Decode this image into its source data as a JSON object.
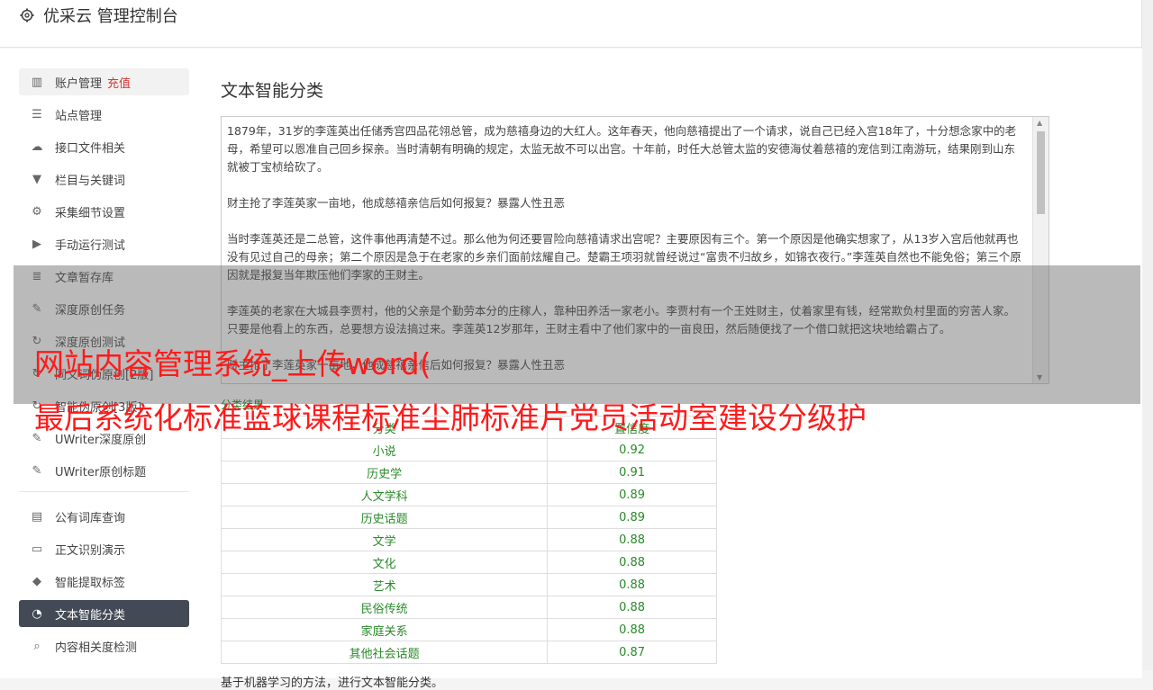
{
  "app": {
    "title": "优采云 管理控制台"
  },
  "sidebar": {
    "group1": [
      {
        "icon": "bar-chart-icon",
        "glyph": "▥",
        "label": "账户管理",
        "extra": "充值"
      },
      {
        "icon": "server-icon",
        "glyph": "☰",
        "label": "站点管理"
      },
      {
        "icon": "cloud-upload-icon",
        "glyph": "☁",
        "label": "接口文件相关"
      },
      {
        "icon": "filter-icon",
        "glyph": "▼",
        "label": "栏目与关键词"
      },
      {
        "icon": "gears-icon",
        "glyph": "⚙",
        "label": "采集细节设置"
      },
      {
        "icon": "play-icon",
        "glyph": "▶",
        "label": "手动运行测试"
      },
      {
        "icon": "database-icon",
        "glyph": "≣",
        "label": "文章暂存库"
      },
      {
        "icon": "edit-icon",
        "glyph": "✎",
        "label": "深度原创任务"
      },
      {
        "icon": "refresh-icon",
        "glyph": "↻",
        "label": "深度原创测试"
      },
      {
        "icon": "refresh-icon",
        "glyph": "↻",
        "label": "同义词伪原创[2版]"
      },
      {
        "icon": "refresh-icon",
        "glyph": "↻",
        "label": "智能伪原创[3版]"
      },
      {
        "icon": "edit-icon",
        "glyph": "✎",
        "label": "UWriter深度原创"
      },
      {
        "icon": "edit-icon",
        "glyph": "✎",
        "label": "UWriter原创标题"
      }
    ],
    "group2": [
      {
        "icon": "book-icon",
        "glyph": "▤",
        "label": "公有词库查询"
      },
      {
        "icon": "monitor-icon",
        "glyph": "▭",
        "label": "正文识别演示"
      },
      {
        "icon": "tag-icon",
        "glyph": "◆",
        "label": "智能提取标签"
      },
      {
        "icon": "pie-chart-icon",
        "glyph": "◔",
        "label": "文本智能分类"
      },
      {
        "icon": "search-icon",
        "glyph": "⌕",
        "label": "内容相关度检测"
      }
    ]
  },
  "main": {
    "title": "文本智能分类",
    "input_text": "1879年，31岁的李莲英出任储秀宫四品花翎总管，成为慈禧身边的大红人。这年春天，他向慈禧提出了一个请求，说自己已经入宫18年了，十分想念家中的老母，希望可以恩准自己回乡探亲。当时清朝有明确的规定，太监无故不可以出宫。十年前，时任大总管太监的安德海仗着慈禧的宠信到江南游玩，结果刚到山东就被丁宝桢给砍了。\n\n财主抢了李莲英家一亩地，他成慈禧亲信后如何报复？暴露人性丑恶\n\n当时李莲英还是二总管，这件事他再清楚不过。那么他为何还要冒险向慈禧请求出宫呢？主要原因有三个。第一个原因是他确实想家了，从13岁入宫后他就再也没有见过自己的母亲；第二个原因是急于在老家的乡亲们面前炫耀自己。楚霸王项羽就曾经说过“富贵不归故乡，如锦衣夜行。”李莲英自然也不能免俗；第三个原因就是报复当年欺压他们李家的王财主。\n\n李莲英的老家在大城县李贾村，他的父亲是个勤劳本分的庄稼人，靠种田养活一家老小。李贾村有一个王姓财主，仗着家里有钱，经常欺负村里面的穷苦人家。只要是他看上的东西，总要想方设法搞过来。李莲英12岁那年，王财主看中了他们家中的一亩良田，然后随便找了一个借口就把这块地给霸占了。\n\n财主抢了李莲英家一亩地，他成慈禧亲信后如何报复？暴露人性丑恶",
    "result_label": "分类结果",
    "table": {
      "headers": [
        "分类",
        "置信度"
      ],
      "rows": [
        [
          "小说",
          "0.92"
        ],
        [
          "历史学",
          "0.91"
        ],
        [
          "人文学科",
          "0.89"
        ],
        [
          "历史话题",
          "0.89"
        ],
        [
          "文学",
          "0.88"
        ],
        [
          "文化",
          "0.88"
        ],
        [
          "艺术",
          "0.88"
        ],
        [
          "民俗传统",
          "0.88"
        ],
        [
          "家庭关系",
          "0.88"
        ],
        [
          "其他社会话题",
          "0.87"
        ]
      ]
    },
    "footer_note": "基于机器学习的方法，进行文本智能分类。"
  },
  "overlay": {
    "line1": "网站内容管理系统_上传word(",
    "line2": "最后系统化标准篮球课程标准尘肺标准片党员活动室建设分级护"
  },
  "colors": {
    "accent_red": "#d9342b",
    "active_bg": "#444a55",
    "result_green": "#2a8a2a",
    "overlay_text": "#ff1a1a"
  }
}
